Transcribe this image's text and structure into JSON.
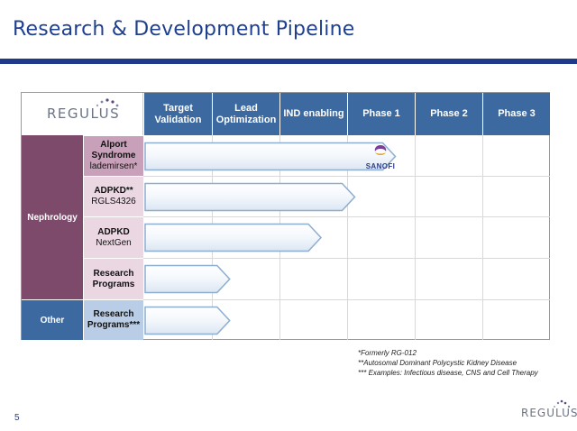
{
  "slide": {
    "title": "Research & Development Pipeline",
    "page_number": "5"
  },
  "logo": {
    "text": "REGULUS"
  },
  "columns": [
    "Target\nValidation",
    "Lead\nOptimization",
    "IND enabling",
    "Phase 1",
    "Phase 2",
    "Phase 3"
  ],
  "areas": {
    "nephrology": "Nephrology",
    "other": "Other"
  },
  "programs": [
    {
      "name": "Alport Syndrome",
      "sub": "lademirsen*",
      "stage_reached": 3.7
    },
    {
      "name": "ADPKD**",
      "sub": "RGLS4326",
      "stage_reached": 3.1
    },
    {
      "name": "ADPKD",
      "sub": "NextGen",
      "stage_reached": 2.6
    },
    {
      "name": "Research Programs",
      "sub": "",
      "stage_reached": 1.25
    },
    {
      "name": "Research Programs***",
      "sub": "",
      "stage_reached": 1.25
    }
  ],
  "partner": {
    "name": "SANOFI",
    "icon": "sanofi-logo-icon"
  },
  "footnotes": [
    "*Formerly RG-012",
    "**Autosomal Dominant Polycystic Kidney Disease",
    "*** Examples: Infectious disease, CNS and Cell Therapy"
  ],
  "colors": {
    "title": "#1f3f8f",
    "header": "#3c6aa0",
    "nephrology": "#7d4a6b",
    "arrow_stroke": "#8eaed0"
  }
}
